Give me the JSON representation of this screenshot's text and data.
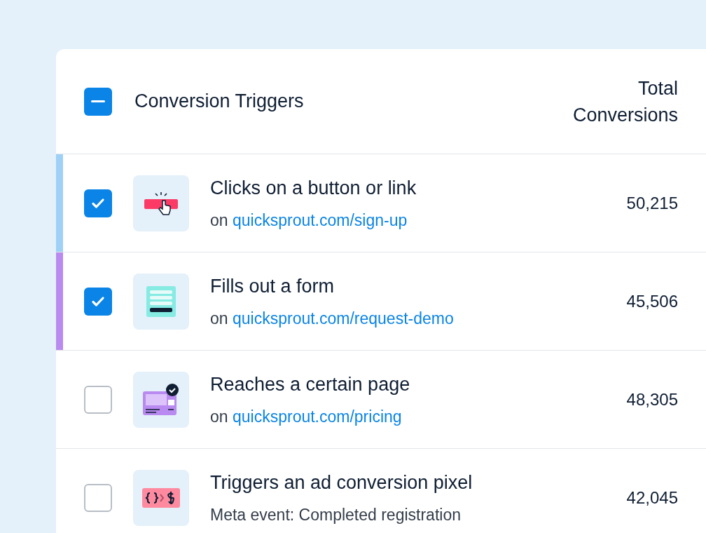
{
  "header": {
    "indeterminate": true,
    "title": "Conversion Triggers",
    "total_label": "Total Conversions"
  },
  "rows": [
    {
      "kind": "click",
      "checked": true,
      "color": "#9fd0f6",
      "title": "Clicks on a button or link",
      "prefix": "on",
      "link": "quicksprout.com/sign-up",
      "value": "50,215"
    },
    {
      "kind": "form",
      "checked": true,
      "color": "#b98af0",
      "title": "Fills out a form",
      "prefix": "on",
      "link": "quicksprout.com/request-demo",
      "value": "45,506"
    },
    {
      "kind": "page",
      "checked": false,
      "title": "Reaches a certain page",
      "prefix": "on",
      "link": "quicksprout.com/pricing",
      "value": "48,305"
    },
    {
      "kind": "pixel",
      "checked": false,
      "title": "Triggers an ad conversion pixel",
      "subtitle": "Meta event: Completed registration",
      "value": "42,045"
    }
  ]
}
